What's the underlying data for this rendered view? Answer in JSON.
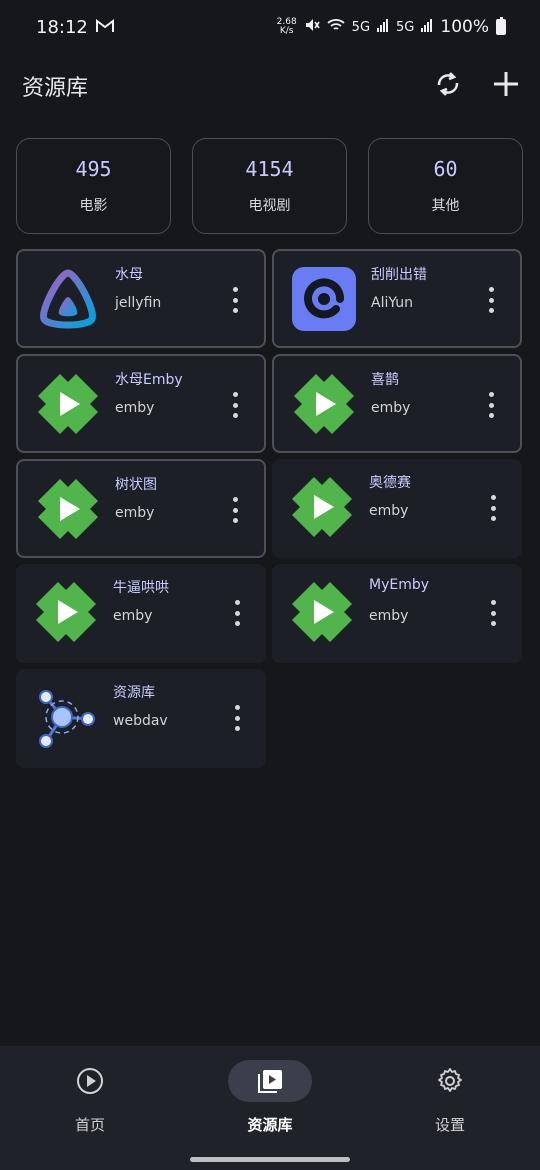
{
  "status_bar": {
    "time": "18:12",
    "net_speed_top": "2.68",
    "net_speed_bottom": "K/s",
    "signal1": "5G",
    "signal2": "5G",
    "battery": "100%"
  },
  "app_bar": {
    "title": "资源库"
  },
  "stats": [
    {
      "value": "495",
      "label": "电影"
    },
    {
      "value": "4154",
      "label": "电视剧"
    },
    {
      "value": "60",
      "label": "其他"
    }
  ],
  "libraries": [
    {
      "name": "水母",
      "type": "jellyfin",
      "logo": "jellyfin-logo"
    },
    {
      "name": "刮削出错",
      "type": "AliYun",
      "logo": "aliyun-logo"
    },
    {
      "name": "水母Emby",
      "type": "emby",
      "logo": "emby-logo"
    },
    {
      "name": "喜鹊",
      "type": "emby",
      "logo": "emby-logo"
    },
    {
      "name": "树状图",
      "type": "emby",
      "logo": "emby-logo"
    },
    {
      "name": "奥德赛",
      "type": "emby",
      "logo": "emby-logo"
    },
    {
      "name": "牛逼哄哄",
      "type": "emby",
      "logo": "emby-logo"
    },
    {
      "name": "MyEmby",
      "type": "emby",
      "logo": "emby-logo"
    },
    {
      "name": "资源库",
      "type": "webdav",
      "logo": "webdav-logo"
    }
  ],
  "bottom_nav": [
    {
      "label": "首页",
      "icon": "play-circle-icon"
    },
    {
      "label": "资源库",
      "icon": "video-library-icon"
    },
    {
      "label": "设置",
      "icon": "gear-icon"
    }
  ],
  "colors": {
    "accent": "#c5cbff",
    "emby_green": "#52b54b",
    "background": "#16171b"
  }
}
